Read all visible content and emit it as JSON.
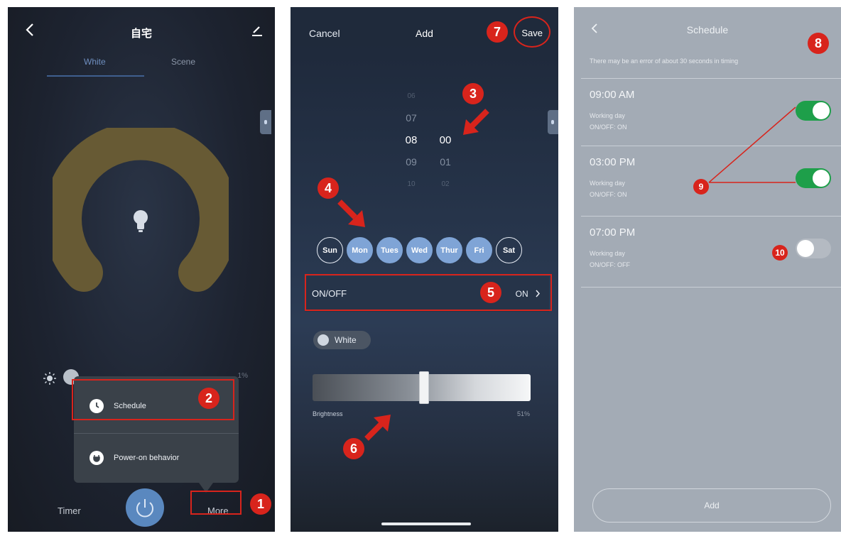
{
  "colors": {
    "accent_blue": "#7fa4d6",
    "toggle_green": "#1e9f4a",
    "annotation_red": "#d8241c"
  },
  "panel1": {
    "header": {
      "title": "自宅",
      "back_icon": "chevron-left-icon",
      "edit_icon": "pencil-icon"
    },
    "tabs": [
      {
        "label": "White",
        "active": true
      },
      {
        "label": "Scene",
        "active": false
      }
    ],
    "brightness_pct": "1%",
    "more_menu": {
      "items": [
        {
          "label": "Schedule",
          "icon": "clock-icon"
        },
        {
          "label": "Power-on behavior",
          "icon": "plug-icon"
        }
      ]
    },
    "bottom_bar": {
      "timer": "Timer",
      "more": "More",
      "power_icon": "power-icon"
    }
  },
  "panel2": {
    "header": {
      "cancel": "Cancel",
      "title": "Add",
      "save": "Save"
    },
    "time_picker": {
      "hours": [
        "06",
        "07",
        "08",
        "09",
        "10"
      ],
      "minutes": [
        "",
        "",
        "00",
        "01",
        "02"
      ],
      "selected_hour": "08",
      "selected_minute": "00"
    },
    "days": [
      {
        "label": "Sun",
        "selected": false
      },
      {
        "label": "Mon",
        "selected": true
      },
      {
        "label": "Tues",
        "selected": true
      },
      {
        "label": "Wed",
        "selected": true
      },
      {
        "label": "Thur",
        "selected": true
      },
      {
        "label": "Fri",
        "selected": true
      },
      {
        "label": "Sat",
        "selected": false
      }
    ],
    "onoff": {
      "label": "ON/OFF",
      "value": "ON"
    },
    "white_chip": {
      "label": "White"
    },
    "brightness": {
      "label": "Brightness",
      "value_text": "51%",
      "value": 0.51
    }
  },
  "panel3": {
    "header": {
      "title": "Schedule"
    },
    "note": "There may be an error of about 30 seconds in timing",
    "schedules": [
      {
        "time": "09:00 AM",
        "repeat": "Working day",
        "action": "ON/OFF: ON",
        "enabled": true
      },
      {
        "time": "03:00 PM",
        "repeat": "Working day",
        "action": "ON/OFF: ON",
        "enabled": true
      },
      {
        "time": "07:00 PM",
        "repeat": "Working day",
        "action": "ON/OFF: OFF",
        "enabled": false
      }
    ],
    "add_button": "Add"
  },
  "annotations": [
    "1",
    "2",
    "3",
    "4",
    "5",
    "6",
    "7",
    "8",
    "9",
    "10"
  ]
}
